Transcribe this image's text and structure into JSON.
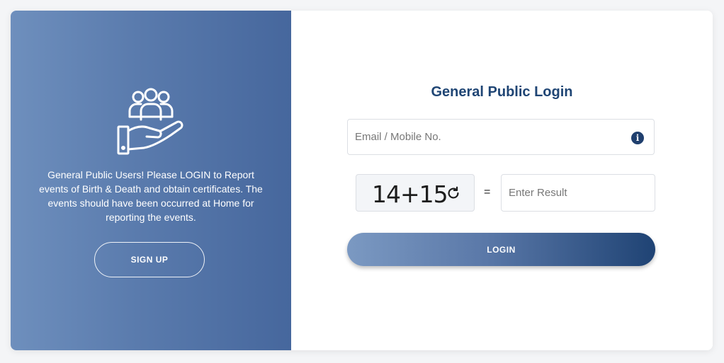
{
  "left_panel": {
    "icon": "people-in-hand-icon",
    "description": "General Public Users! Please LOGIN to Report events of Birth & Death and obtain certificates. The events should have been occurred at Home for reporting the events.",
    "signup_label": "SIGN UP"
  },
  "login_form": {
    "title": "General Public Login",
    "email_placeholder": "Email / Mobile No.",
    "email_value": "",
    "info_icon": "info-icon",
    "captcha_text": "14+15",
    "refresh_icon": "refresh-icon",
    "equals_sign": "=",
    "result_placeholder": "Enter Result",
    "result_value": "",
    "login_label": "LOGIN"
  },
  "colors": {
    "accent": "#1f4574",
    "left_gradient_start": "#6e8fbd",
    "left_gradient_end": "#46679d"
  }
}
